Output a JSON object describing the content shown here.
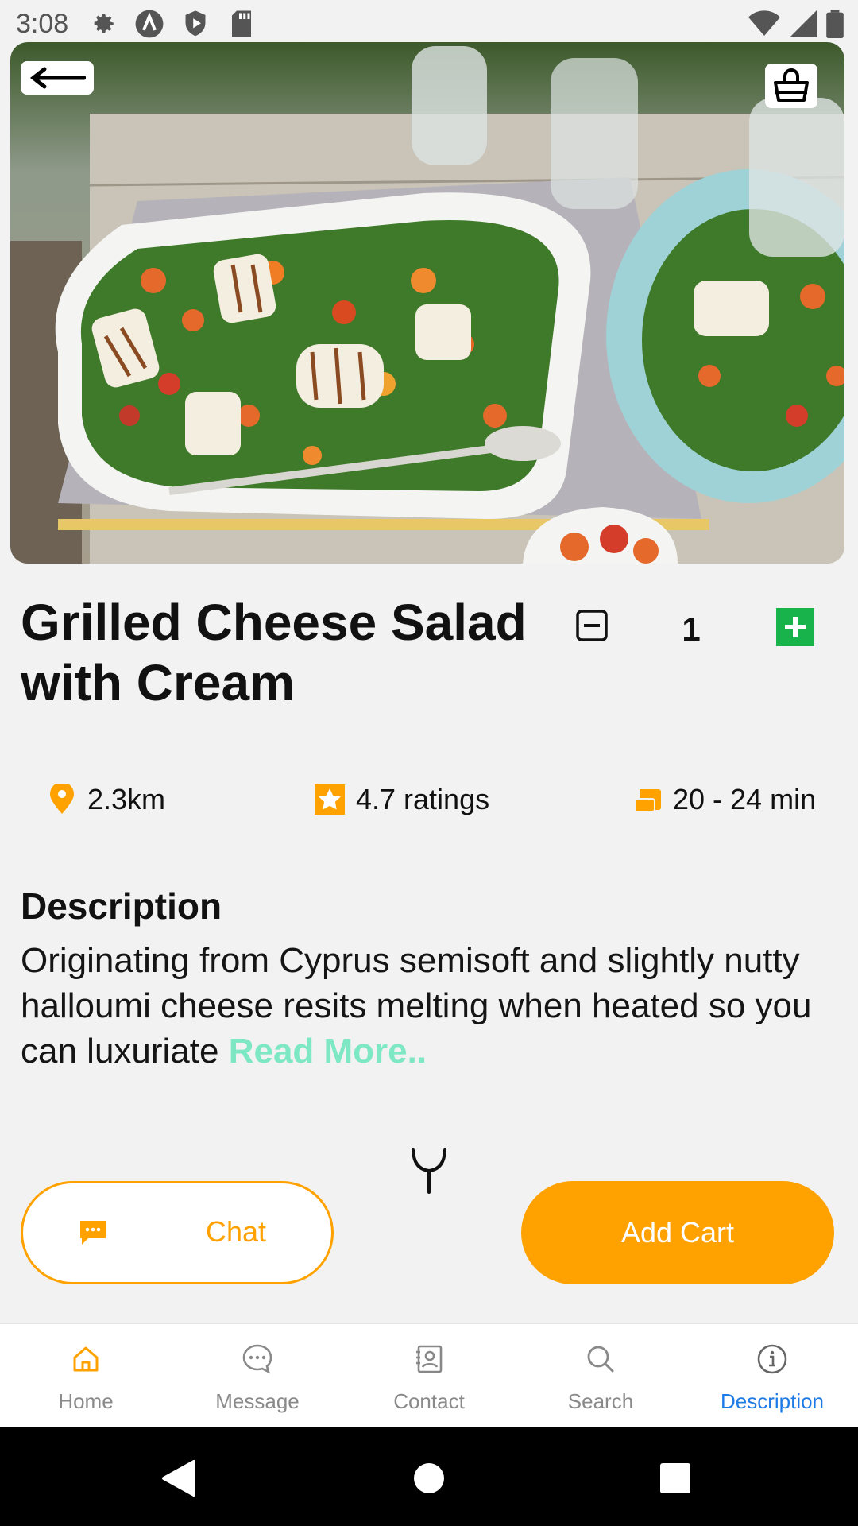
{
  "status_bar": {
    "time": "3:08",
    "icons_left": [
      "gear-icon",
      "a-circle-icon",
      "shield-play-icon",
      "sd-card-icon"
    ],
    "icons_right": [
      "wifi-icon",
      "signal-icon",
      "battery-icon"
    ]
  },
  "hero": {
    "back_icon": "arrow-left-icon",
    "cart_icon": "shopping-bag-icon"
  },
  "product": {
    "title": "Grilled Cheese Salad with Cream",
    "quantity": "1"
  },
  "info": {
    "distance": "2.3km",
    "rating": "4.7 ratings",
    "time": "20 - 24 min"
  },
  "description": {
    "heading": "Description",
    "body": "Originating from Cyprus semisoft and slightly nutty halloumi cheese resits melting when heated so you can luxuriate ",
    "read_more": "Read More.."
  },
  "actions": {
    "chat_label": "Chat",
    "add_cart_label": "Add Cart"
  },
  "bottom_nav": {
    "items": [
      {
        "label": "Home",
        "icon": "home-icon"
      },
      {
        "label": "Message",
        "icon": "message-icon"
      },
      {
        "label": "Contact",
        "icon": "contact-icon"
      },
      {
        "label": "Search",
        "icon": "search-icon"
      },
      {
        "label": "Description",
        "icon": "info-icon"
      }
    ],
    "active": "Description"
  },
  "colors": {
    "accent": "#ffa200",
    "plus_green": "#18b34a",
    "read_more": "#7de8c3",
    "nav_active": "#1e7be6"
  }
}
